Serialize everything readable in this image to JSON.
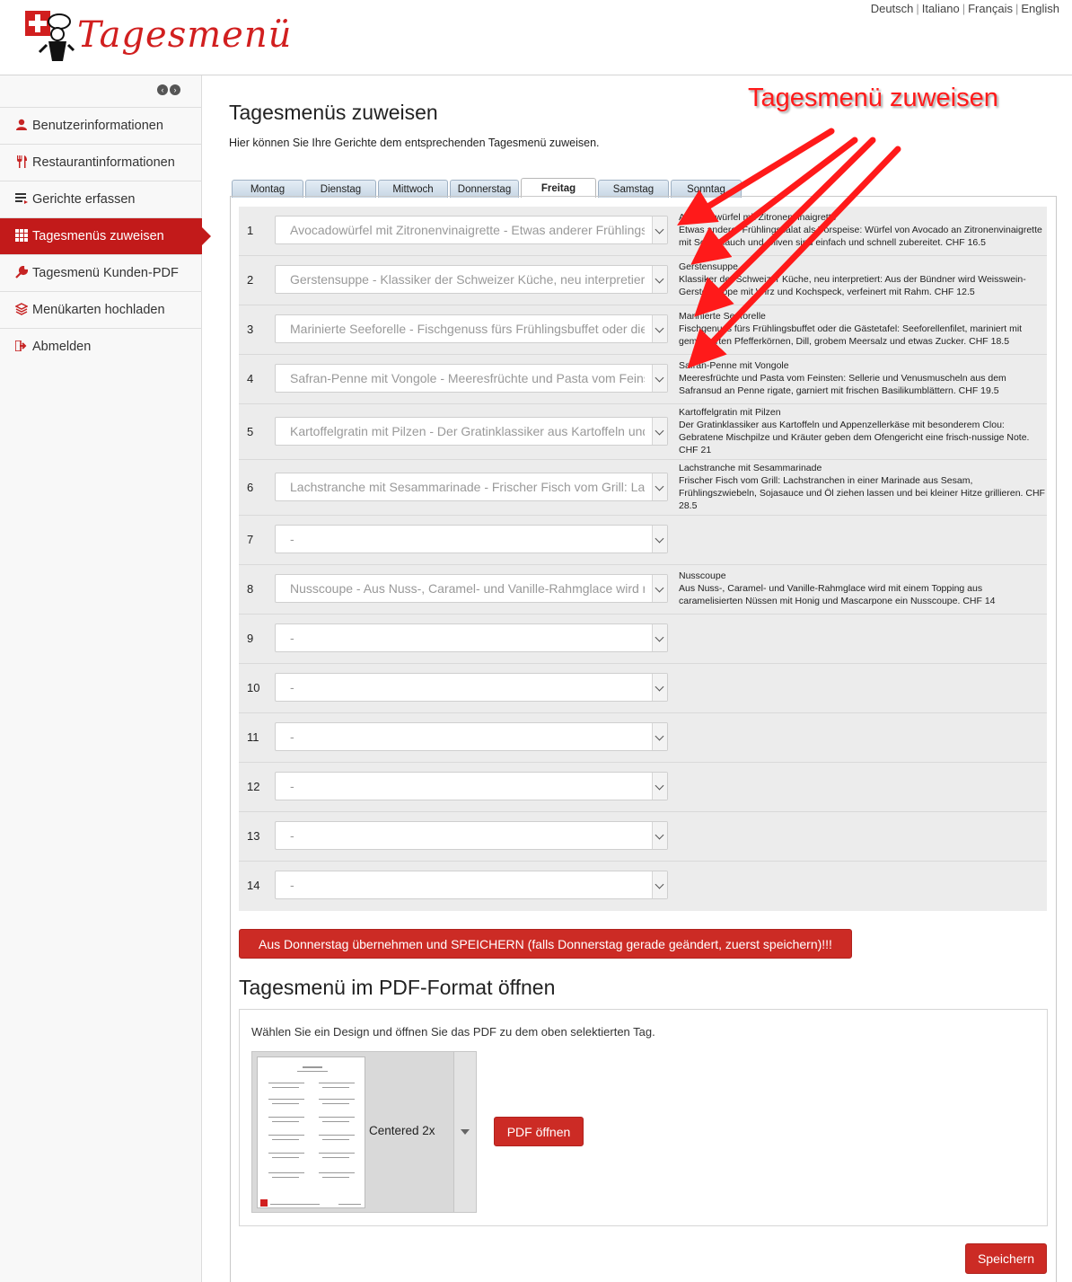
{
  "brand": {
    "name": "Tagesmenü",
    "accent": "#c21a1a"
  },
  "languages": [
    "Deutsch",
    "Italiano",
    "Français",
    "English"
  ],
  "sidebar": {
    "items": [
      {
        "label": "Benutzerinformationen",
        "icon": "user-icon",
        "active": false
      },
      {
        "label": "Restaurantinformationen",
        "icon": "cutlery-icon",
        "active": false
      },
      {
        "label": "Gerichte erfassen",
        "icon": "list-icon",
        "active": false
      },
      {
        "label": "Tagesmenüs zuweisen",
        "icon": "grid-icon",
        "active": true
      },
      {
        "label": "Tagesmenü Kunden-PDF",
        "icon": "wrench-icon",
        "active": false
      },
      {
        "label": "Menükarten hochladen",
        "icon": "layers-icon",
        "active": false
      },
      {
        "label": "Abmelden",
        "icon": "logout-icon",
        "active": false
      }
    ]
  },
  "main": {
    "title": "Tagesmenüs zuweisen",
    "subtitle": "Hier können Sie Ihre Gerichte dem entsprechenden Tagesmenü zuweisen.",
    "tabs": [
      "Montag",
      "Dienstag",
      "Mittwoch",
      "Donnerstag",
      "Freitag",
      "Samstag",
      "Sonntag"
    ],
    "active_tab": "Freitag",
    "rows": [
      {
        "num": "1",
        "value": "Avocadowürfel mit Zitronenvinaigrette - Etwas anderer Frühlingssalat als Vorspeise",
        "desc": "Avocadowürfel mit Zitronenvinaigrette\nEtwas anderer Frühlingssalat als Vorspeise: Würfel von Avocado an Zitronenvinaigrette mit Schnittlauch und Oliven sind einfach und schnell zubereitet. CHF 16.5"
      },
      {
        "num": "2",
        "value": "Gerstensuppe - Klassiker der Schweizer Küche, neu interpretiert",
        "desc": "Gerstensuppe\nKlassiker der Schweizer Küche, neu interpretiert: Aus der Bündner wird Weisswein-Gerstensuppe mit Wirz und Kochspeck, verfeinert mit Rahm. CHF 12.5"
      },
      {
        "num": "3",
        "value": "Marinierte Seeforelle - Fischgenuss fürs Frühlingsbuffet oder die Gästetafel",
        "desc": "Marinierte Seeforelle\nFischgenuss fürs Frühlingsbuffet oder die Gästetafel: Seeforellenfilet, mariniert mit gemörserten Pfefferkörnen, Dill, grobem Meersalz und etwas Zucker. CHF 18.5"
      },
      {
        "num": "4",
        "value": "Safran-Penne mit Vongole - Meeresfrüchte und Pasta vom Feinsten",
        "desc": "Safran-Penne mit Vongole\nMeeresfrüchte und Pasta vom Feinsten: Sellerie und Venusmuscheln aus dem Safransud an Penne rigate, garniert mit frischen Basilikumblättern. CHF 19.5"
      },
      {
        "num": "5",
        "value": "Kartoffelgratin mit Pilzen - Der Gratinklassiker aus Kartoffeln und Appenzellerkäse",
        "desc": "Kartoffelgratin mit Pilzen\nDer Gratinklassiker aus Kartoffeln und Appenzellerkäse mit besonderem Clou: Gebratene Mischpilze und Kräuter geben dem Ofengericht eine frisch-nussige Note. CHF 21"
      },
      {
        "num": "6",
        "value": "Lachstranche mit Sesammarinade - Frischer Fisch vom Grill: Lachstranchen",
        "desc": "Lachstranche mit Sesammarinade\nFrischer Fisch vom Grill: Lachstranchen in einer Marinade aus Sesam, Frühlingszwiebeln, Sojasauce und Öl ziehen lassen und bei kleiner Hitze grillieren. CHF 28.5"
      },
      {
        "num": "7",
        "value": "-",
        "desc": ""
      },
      {
        "num": "8",
        "value": "Nusscoupe - Aus Nuss-, Caramel- und Vanille-Rahmglace wird mit einem Topping",
        "desc": "Nusscoupe\nAus Nuss-, Caramel- und Vanille-Rahmglace wird mit einem Topping aus caramelisierten Nüssen mit Honig und Mascarpone ein Nusscoupe. CHF 14"
      },
      {
        "num": "9",
        "value": "-",
        "desc": ""
      },
      {
        "num": "10",
        "value": "-",
        "desc": ""
      },
      {
        "num": "11",
        "value": "-",
        "desc": ""
      },
      {
        "num": "12",
        "value": "-",
        "desc": ""
      },
      {
        "num": "13",
        "value": "-",
        "desc": ""
      },
      {
        "num": "14",
        "value": "-",
        "desc": ""
      }
    ],
    "copy_button": "Aus Donnerstag übernehmen und SPEICHERN (falls Donnerstag gerade geändert, zuerst speichern)!!!"
  },
  "pdf": {
    "title": "Tagesmenü im PDF-Format öffnen",
    "description": "Wählen Sie ein Design und öffnen Sie das PDF zu dem oben selektierten Tag.",
    "design_selected": "Centered 2x",
    "open_button": "PDF öffnen"
  },
  "save_button": "Speichern",
  "annotation": {
    "text": "Tagesmenü zuweisen",
    "color": "#ff1a1a"
  }
}
